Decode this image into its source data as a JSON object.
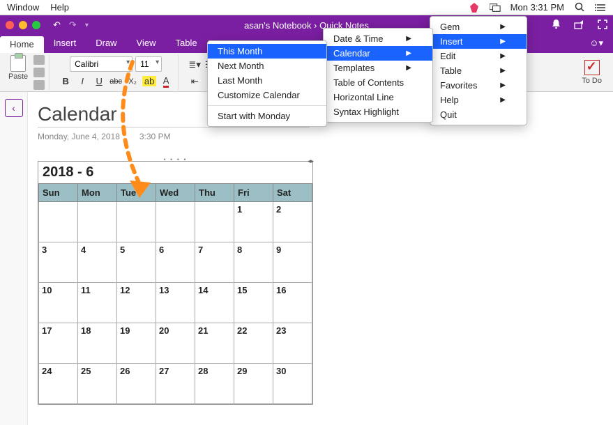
{
  "mac_menubar": {
    "left": [
      "Window",
      "Help"
    ],
    "clock": "Mon 3:31 PM"
  },
  "titlebar": {
    "title": "asan's Notebook › Quick Notes"
  },
  "ribbon_tabs": [
    "Home",
    "Insert",
    "Draw",
    "View",
    "Table"
  ],
  "ribbon": {
    "paste_label": "Paste",
    "font_name": "Calibri",
    "font_size": "11",
    "bold": "B",
    "italic": "I",
    "underline": "U",
    "strike": "abc",
    "subscript": "X₂",
    "todo_label": "To Do"
  },
  "page": {
    "title": "Calendar",
    "date": "Monday, June 4, 2018",
    "time": "3:30 PM"
  },
  "calendar": {
    "heading": "2018 - 6",
    "weekdays": [
      "Sun",
      "Mon",
      "Tue",
      "Wed",
      "Thu",
      "Fri",
      "Sat"
    ],
    "rows": [
      [
        "",
        "",
        "",
        "",
        "",
        "1",
        "2"
      ],
      [
        "",
        "",
        "",
        "",
        "",
        "",
        ""
      ],
      [
        "3",
        "4",
        "5",
        "6",
        "7",
        "8",
        "9"
      ],
      [
        "",
        "",
        "",
        "",
        "",
        "",
        ""
      ],
      [
        "10",
        "11",
        "12",
        "13",
        "14",
        "15",
        "16"
      ],
      [
        "",
        "",
        "",
        "",
        "",
        "",
        ""
      ],
      [
        "17",
        "18",
        "19",
        "20",
        "21",
        "22",
        "23"
      ],
      [
        "",
        "",
        "",
        "",
        "",
        "",
        ""
      ],
      [
        "24",
        "25",
        "26",
        "27",
        "28",
        "29",
        "30"
      ]
    ]
  },
  "menus": {
    "gem": [
      {
        "label": "Gem",
        "sub": true
      },
      {
        "label": "Insert",
        "sub": true,
        "hl": true
      },
      {
        "label": "Edit",
        "sub": true
      },
      {
        "label": "Table",
        "sub": true
      },
      {
        "label": "Favorites",
        "sub": true
      },
      {
        "label": "Help",
        "sub": true
      },
      {
        "label": "Quit"
      }
    ],
    "insert": [
      {
        "label": "Date & Time",
        "sub": true
      },
      {
        "label": "Calendar",
        "sub": true,
        "hl": true
      },
      {
        "label": "Templates",
        "sub": true
      },
      {
        "label": "Table of Contents"
      },
      {
        "label": "Horizontal Line"
      },
      {
        "label": "Syntax Highlight"
      }
    ],
    "calendar": [
      {
        "label": "This Month",
        "hl": true
      },
      {
        "label": "Next Month"
      },
      {
        "label": "Last Month"
      },
      {
        "label": "Customize Calendar"
      },
      {
        "sep": true
      },
      {
        "label": "Start with Monday"
      }
    ]
  }
}
